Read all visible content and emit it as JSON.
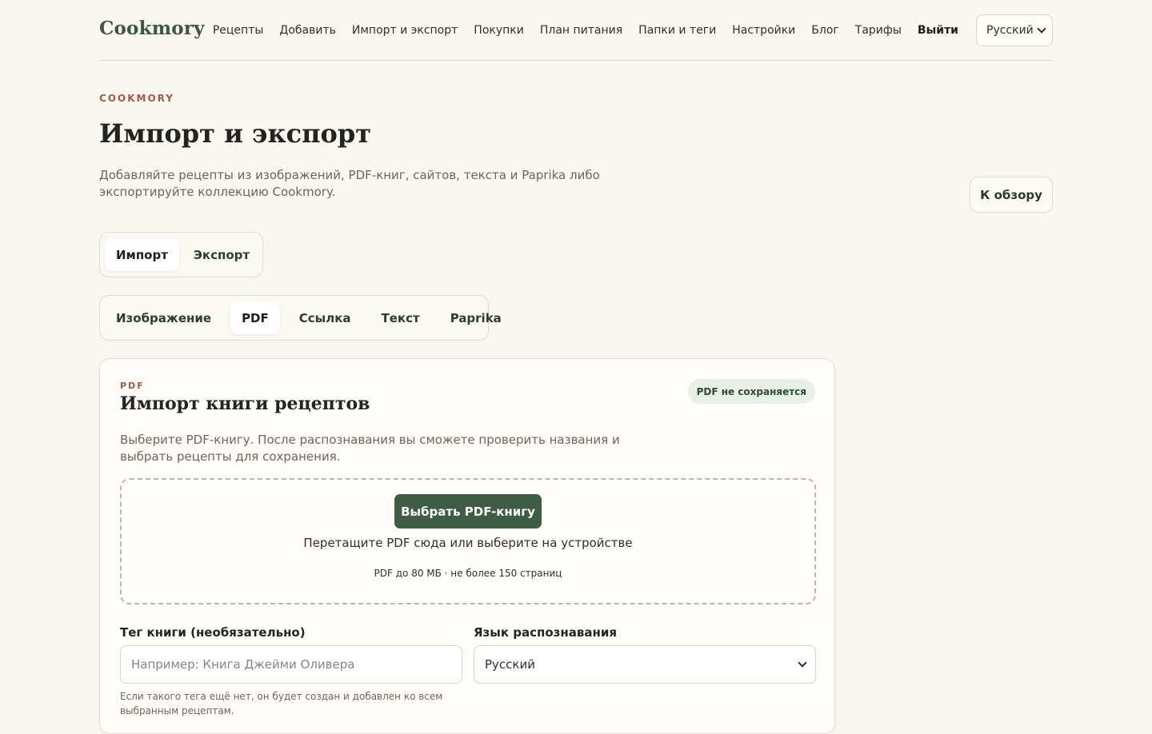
{
  "header": {
    "logo": "Cookmory",
    "nav": [
      "Рецепты",
      "Добавить",
      "Импорт и экспорт",
      "Покупки",
      "План питания",
      "Папки и теги",
      "Настройки",
      "Блог",
      "Тарифы"
    ],
    "logout": "Выйти",
    "language": "Русский"
  },
  "page": {
    "eyebrow": "COOKMORY",
    "title": "Импорт и экспорт",
    "description": "Добавляйте рецепты из изображений, PDF-книг, сайтов, текста и Paprika либо экспортируйте коллекцию Cookmory.",
    "overview_button": "К обзору"
  },
  "mode_tabs": {
    "import": "Импорт",
    "export": "Экспорт",
    "active": "Импорт"
  },
  "source_tabs": {
    "image": "Изображение",
    "pdf": "PDF",
    "link": "Ссылка",
    "text": "Текст",
    "paprika": "Paprika",
    "active": "PDF"
  },
  "card": {
    "eyebrow": "PDF",
    "title": "Импорт книги рецептов",
    "badge": "PDF не сохраняется",
    "description": "Выберите PDF-книгу. После распознавания вы сможете проверить названия и выбрать рецепты для сохранения.",
    "dropzone": {
      "button": "Выбрать PDF-книгу",
      "text": "Перетащите PDF сюда или выберите на устройстве",
      "hint": "PDF до 80 МБ · не более 150 страниц"
    },
    "tag_field": {
      "label": "Тег книги (необязательно)",
      "placeholder": "Например: Книга Джейми Оливера",
      "help": "Если такого тега ещё нет, он будет создан и добавлен ко всем выбранным рецептам."
    },
    "language_field": {
      "label": "Язык распознавания",
      "value": "Русский"
    }
  }
}
